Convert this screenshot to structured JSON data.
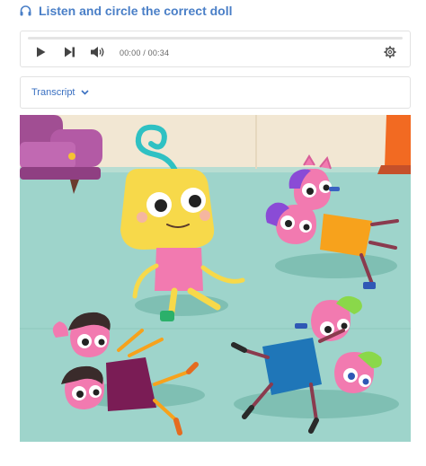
{
  "header": {
    "title": "Listen and circle the correct doll",
    "icon": "headphones-icon",
    "color": "#4a7fc7"
  },
  "player": {
    "time_display": "00:00 / 00:34",
    "progress_fraction": 0.0,
    "controls": [
      "play-icon",
      "skip-forward-icon",
      "volume-icon",
      "settings-icon"
    ]
  },
  "transcript": {
    "label": "Transcript",
    "icon": "chevron-down-icon",
    "color": "#3a70c1"
  },
  "illustration": {
    "floor_color": "#9ed4cb",
    "wall_color": "#f2e7d3"
  }
}
